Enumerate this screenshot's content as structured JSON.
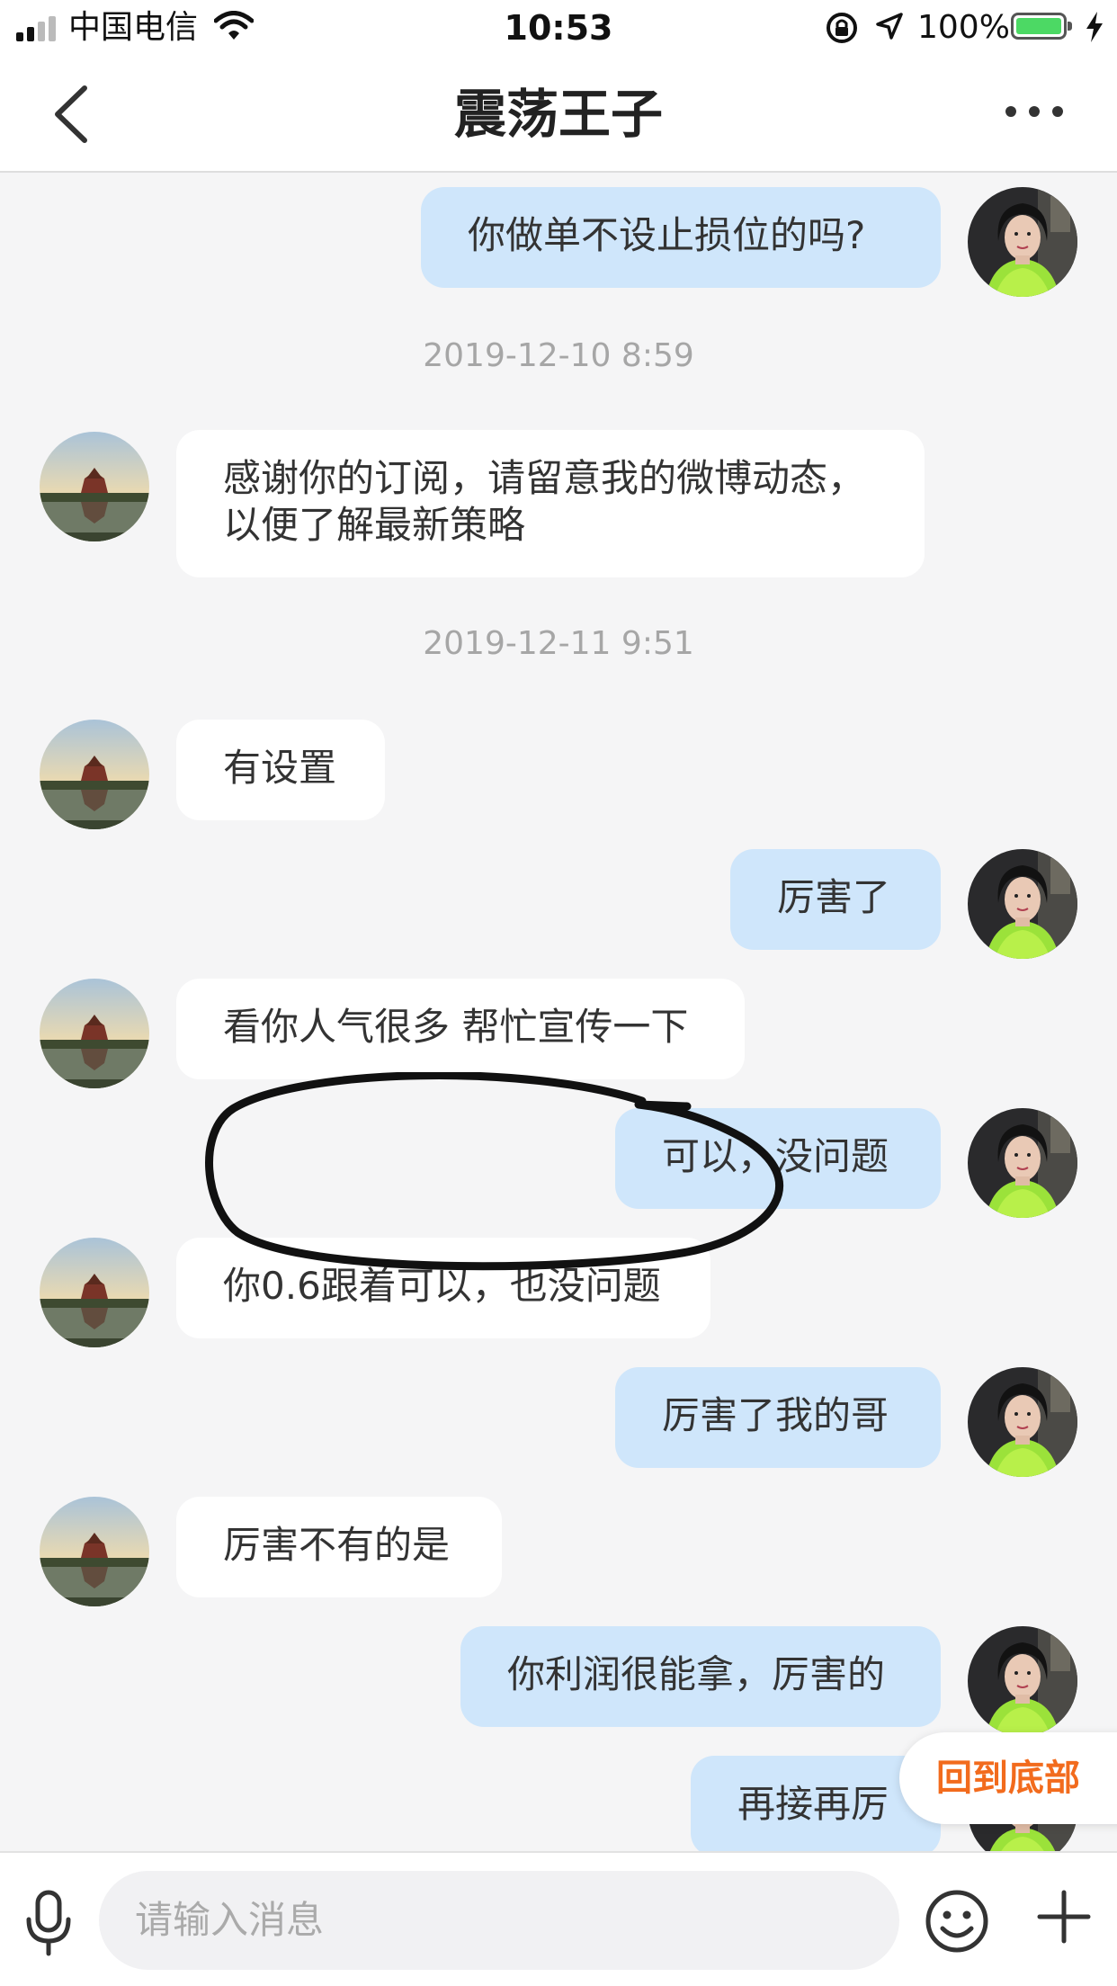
{
  "status_bar": {
    "carrier": "中国电信",
    "time": "10:53",
    "battery_percent": "100%",
    "battery_color": "#4cd964"
  },
  "nav": {
    "title": "震荡王子",
    "back_icon": "chevron-left-icon",
    "more_icon": "more-dots-icon"
  },
  "messages": [
    {
      "type": "message",
      "side": "out",
      "text": "你做单不设止损位的吗?"
    },
    {
      "type": "time",
      "text": "2019-12-10 8:59"
    },
    {
      "type": "message",
      "side": "in",
      "text": "感谢你的订阅，请留意我的微博动态，以便了解最新策略"
    },
    {
      "type": "time",
      "text": "2019-12-11 9:51"
    },
    {
      "type": "message",
      "side": "in",
      "text": "有设置"
    },
    {
      "type": "message",
      "side": "out",
      "text": "厉害了"
    },
    {
      "type": "message",
      "side": "in",
      "text": "看你人气很多 帮忙宣传一下"
    },
    {
      "type": "message",
      "side": "out",
      "text": "可以，没问题"
    },
    {
      "type": "message",
      "side": "in",
      "text": "你0.6跟着可以，也没问题"
    },
    {
      "type": "message",
      "side": "out",
      "text": "厉害了我的哥"
    },
    {
      "type": "message",
      "side": "in",
      "text": "厉害不有的是"
    },
    {
      "type": "message",
      "side": "out",
      "text": "你利润很能拿，厉害的"
    },
    {
      "type": "message",
      "side": "out",
      "text": "再接再厉"
    }
  ],
  "back_to_bottom": "回到底部",
  "input": {
    "placeholder": "请输入消息",
    "mic_icon": "microphone-icon",
    "emoji_icon": "smiley-icon",
    "plus_icon": "plus-icon"
  },
  "colors": {
    "incoming_bubble": "#ffffff",
    "outgoing_bubble": "#cfe6fb",
    "accent": "#f26b1d",
    "background": "#f5f5f6"
  }
}
